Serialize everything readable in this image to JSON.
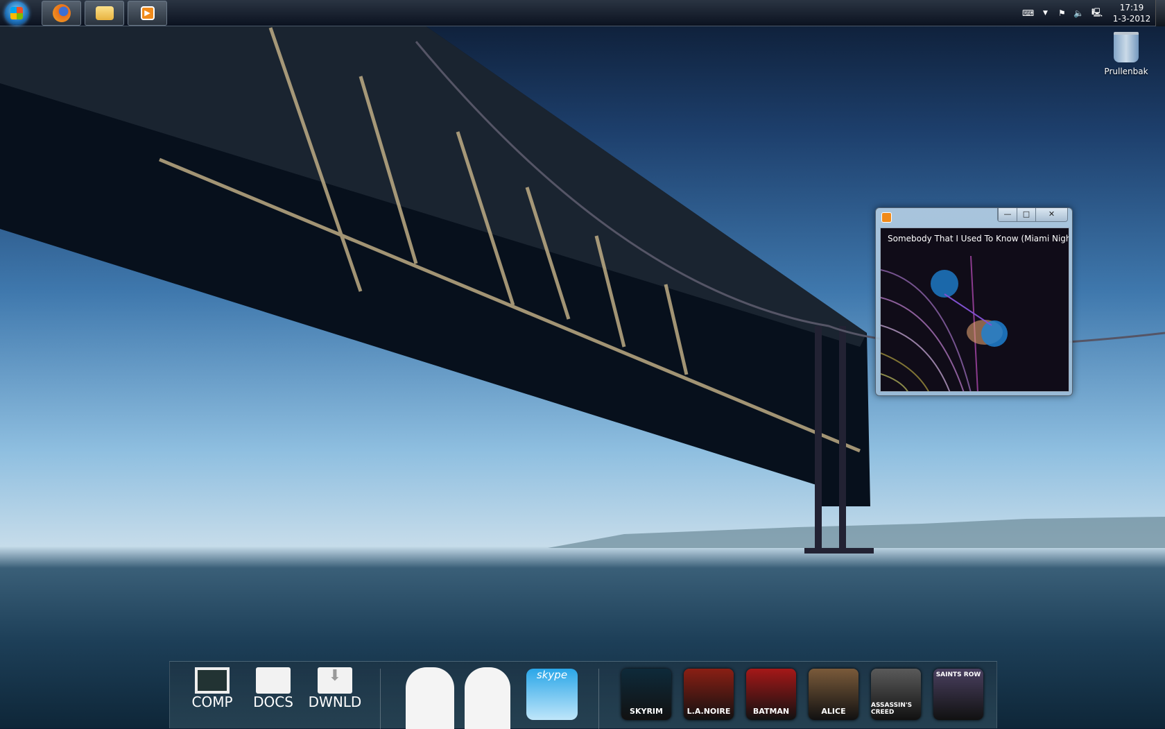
{
  "taskbar": {
    "start": "start-orb",
    "buttons": [
      {
        "name": "firefox",
        "icon": "firefox-icon",
        "color": "#e8701c"
      },
      {
        "name": "windows-explorer",
        "icon": "folder-icon",
        "color": "#f4c64a"
      },
      {
        "name": "windows-media-player",
        "icon": "media-player-icon",
        "color": "#f08a1a"
      }
    ],
    "tray": {
      "time": "17:19",
      "date": "1-3-2012"
    }
  },
  "desktop": {
    "recycle_bin": "Prullenbak"
  },
  "media_player": {
    "now_playing": "Somebody That I Used To Know  (Miami Nigh...",
    "minimize": "—",
    "maximize": "□",
    "close": "✕"
  },
  "dock": {
    "places": [
      {
        "label": "COMP"
      },
      {
        "label": "DOCS"
      },
      {
        "label": "DWNLD"
      }
    ],
    "skype": "skype",
    "games": [
      {
        "label": "SKYRIM",
        "color": "#0e2a3a"
      },
      {
        "label": "L.A.NOIRE",
        "color": "#8a1f14"
      },
      {
        "label": "BATMAN",
        "color": "#a51818"
      },
      {
        "label": "ALICE",
        "color": "#7a5a3a"
      },
      {
        "label": "ASSASSIN'S CREED",
        "color": "#5a5a5a"
      },
      {
        "label": "SAINTS ROW",
        "color": "#4a4060"
      }
    ]
  }
}
